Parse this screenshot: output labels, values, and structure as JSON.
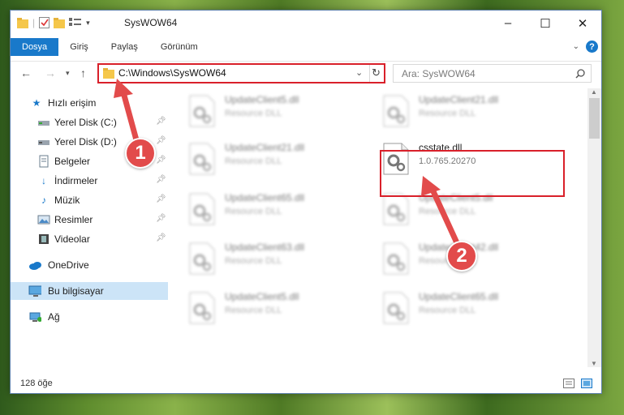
{
  "window": {
    "title": "SysWOW64",
    "ribbon_tabs": [
      "Dosya",
      "Giriş",
      "Paylaş",
      "Görünüm"
    ],
    "help_label": "?",
    "minimize_glyph": "–",
    "maximize_glyph": "☐",
    "close_glyph": "✕"
  },
  "address_bar": {
    "path": "C:\\Windows\\SysWOW64",
    "search_placeholder": "Ara: SysWOW64"
  },
  "nav_pane": {
    "items": [
      {
        "label": "Hızlı erişim",
        "icon": "star-icon",
        "pinned": false
      },
      {
        "label": "Yerel Disk (C:)",
        "icon": "drive-icon",
        "pinned": true
      },
      {
        "label": "Yerel Disk (D:)",
        "icon": "drive-icon",
        "pinned": true
      },
      {
        "label": "Belgeler",
        "icon": "documents-icon",
        "pinned": true
      },
      {
        "label": "İndirmeler",
        "icon": "download-icon",
        "pinned": true
      },
      {
        "label": "Müzik",
        "icon": "music-icon",
        "pinned": true
      },
      {
        "label": "Resimler",
        "icon": "pictures-icon",
        "pinned": true
      },
      {
        "label": "Videolar",
        "icon": "video-icon",
        "pinned": true
      },
      {
        "label": "OneDrive",
        "icon": "cloud-icon",
        "pinned": false
      },
      {
        "label": "Bu bilgisayar",
        "icon": "computer-icon",
        "pinned": false,
        "selected": true
      },
      {
        "label": "Ağ",
        "icon": "network-icon",
        "pinned": false
      }
    ]
  },
  "files": [
    {
      "name": "UpdateClient5.dll",
      "sub": "Resource DLL",
      "blurred": true
    },
    {
      "name": "UpdateClient21.dll",
      "sub": "Resource DLL",
      "blurred": true
    },
    {
      "name": "UpdateClient21.dll",
      "sub": "Resource DLL",
      "blurred": true
    },
    {
      "name": "csstate.dll",
      "sub": "1.0.765.20270",
      "blurred": false,
      "highlighted": true
    },
    {
      "name": "UpdateClient65.dll",
      "sub": "Resource DLL",
      "blurred": true
    },
    {
      "name": "UpdateClient5.dll",
      "sub": "Resource DLL",
      "blurred": true
    },
    {
      "name": "UpdateClient63.dll",
      "sub": "Resource DLL",
      "blurred": true
    },
    {
      "name": "UpdateClient42.dll",
      "sub": "Resource DLL",
      "blurred": true
    },
    {
      "name": "UpdateClient5.dll",
      "sub": "Resource DLL",
      "blurred": true
    },
    {
      "name": "UpdateClient65.dll",
      "sub": "Resource DLL",
      "blurred": true
    }
  ],
  "status": {
    "item_count": "128 öğe"
  },
  "annotations": {
    "step1": "1",
    "step2": "2",
    "color": "#e24b4b"
  },
  "colors": {
    "accent": "#1979ca",
    "highlight_border": "#d9202a",
    "selected_bg": "#cce4f7"
  }
}
